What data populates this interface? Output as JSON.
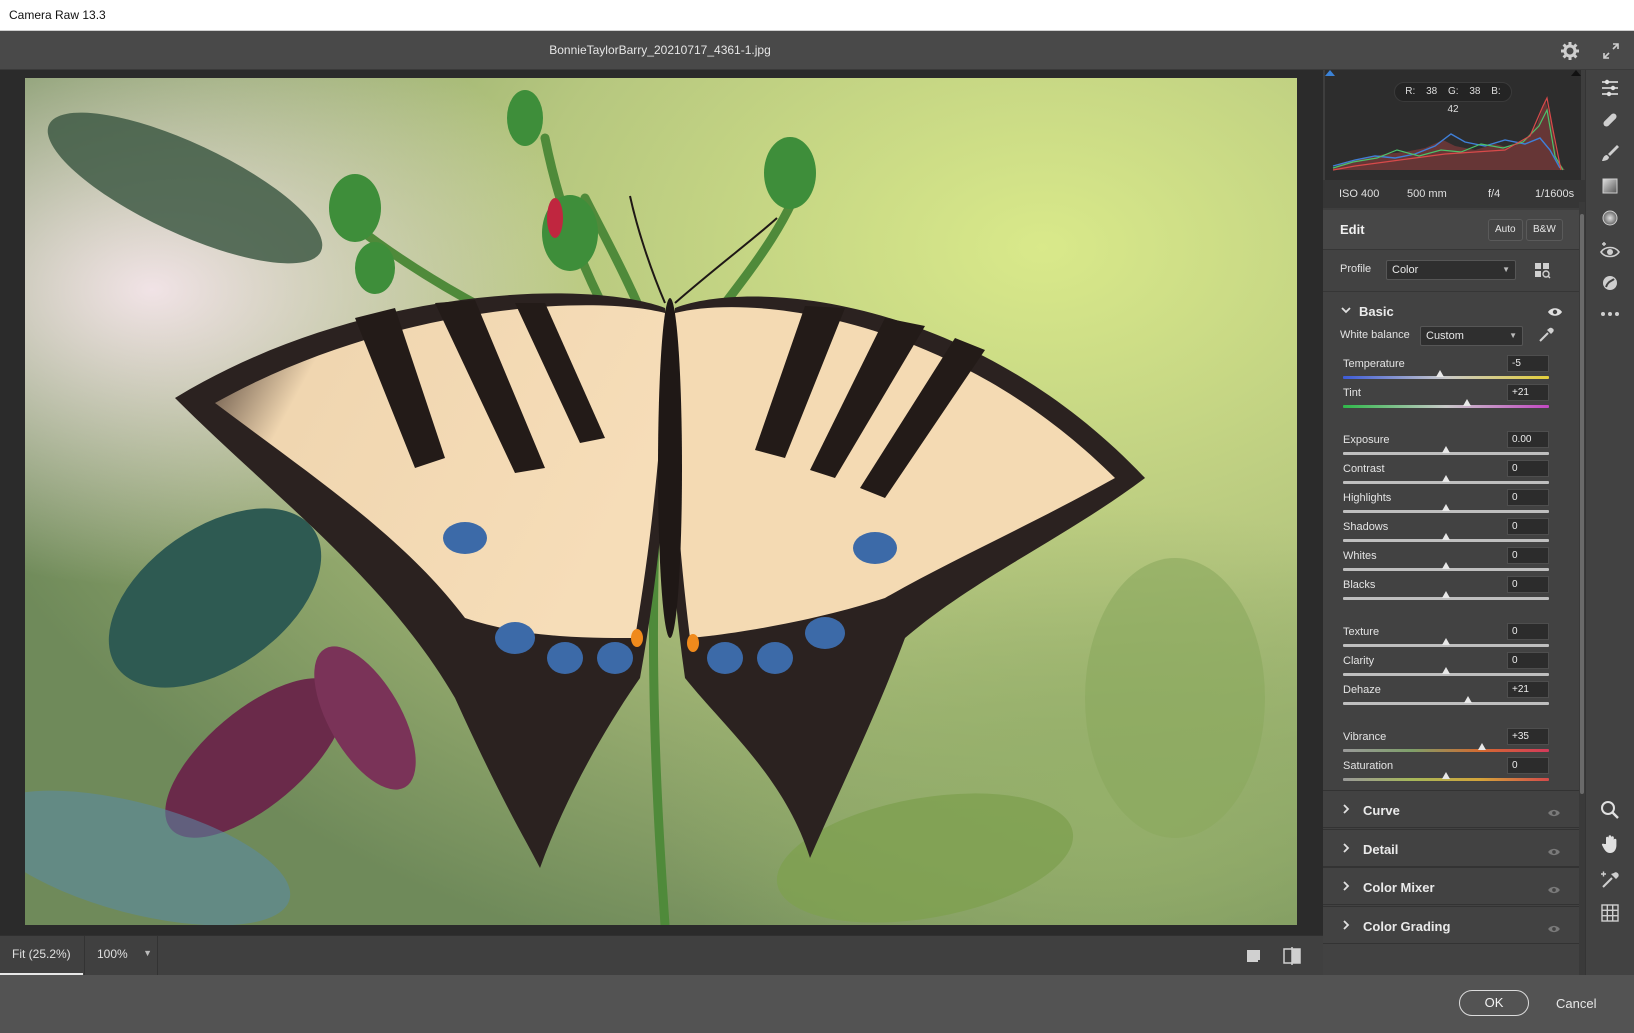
{
  "window": {
    "title": "Camera Raw 13.3"
  },
  "file": {
    "name": "BonnieTaylorBarry_20210717_4361-1.jpg"
  },
  "histogram": {
    "r_label": "R: 38",
    "g_label": "G: 38",
    "b_label": "B: 42"
  },
  "exif": {
    "iso": "ISO 400",
    "focal": "500 mm",
    "aperture": "f/4",
    "shutter": "1/1600s"
  },
  "edit": {
    "title": "Edit",
    "auto_label": "Auto",
    "bw_label": "B&W",
    "profile_label": "Profile",
    "profile_value": "Color"
  },
  "basic": {
    "title": "Basic",
    "wb_label": "White balance",
    "wb_value": "Custom",
    "sliders": [
      {
        "name": "Temperature",
        "value": "-5",
        "pos": 0.47
      },
      {
        "name": "Tint",
        "value": "+21",
        "pos": 0.6
      },
      {
        "name": "Exposure",
        "value": "0.00",
        "pos": 0.5
      },
      {
        "name": "Contrast",
        "value": "0",
        "pos": 0.5
      },
      {
        "name": "Highlights",
        "value": "0",
        "pos": 0.5
      },
      {
        "name": "Shadows",
        "value": "0",
        "pos": 0.5
      },
      {
        "name": "Whites",
        "value": "0",
        "pos": 0.5
      },
      {
        "name": "Blacks",
        "value": "0",
        "pos": 0.5
      },
      {
        "name": "Texture",
        "value": "0",
        "pos": 0.5
      },
      {
        "name": "Clarity",
        "value": "0",
        "pos": 0.5
      },
      {
        "name": "Dehaze",
        "value": "+21",
        "pos": 0.605
      },
      {
        "name": "Vibrance",
        "value": "+35",
        "pos": 0.675
      },
      {
        "name": "Saturation",
        "value": "0",
        "pos": 0.5
      }
    ]
  },
  "sections": [
    {
      "title": "Curve"
    },
    {
      "title": "Detail"
    },
    {
      "title": "Color Mixer"
    },
    {
      "title": "Color Grading"
    }
  ],
  "zoom": {
    "fit_label": "Fit (25.2%)",
    "level_label": "100%"
  },
  "footer": {
    "ok_label": "OK",
    "cancel_label": "Cancel"
  },
  "icons": {
    "settings": "gear-icon",
    "fullscreen": "fullscreen-icon",
    "tools": [
      "edit-sliders-icon",
      "healing-icon",
      "brush-icon",
      "gradient-icon",
      "radial-icon",
      "redeye-icon",
      "presets-icon",
      "more-icon",
      "zoom-icon",
      "hand-icon",
      "color-sampler-icon",
      "grid-icon"
    ]
  },
  "colors": {
    "accent": "#e8e8e8",
    "panel": "#424242",
    "canvas": "#2b2b2b"
  }
}
